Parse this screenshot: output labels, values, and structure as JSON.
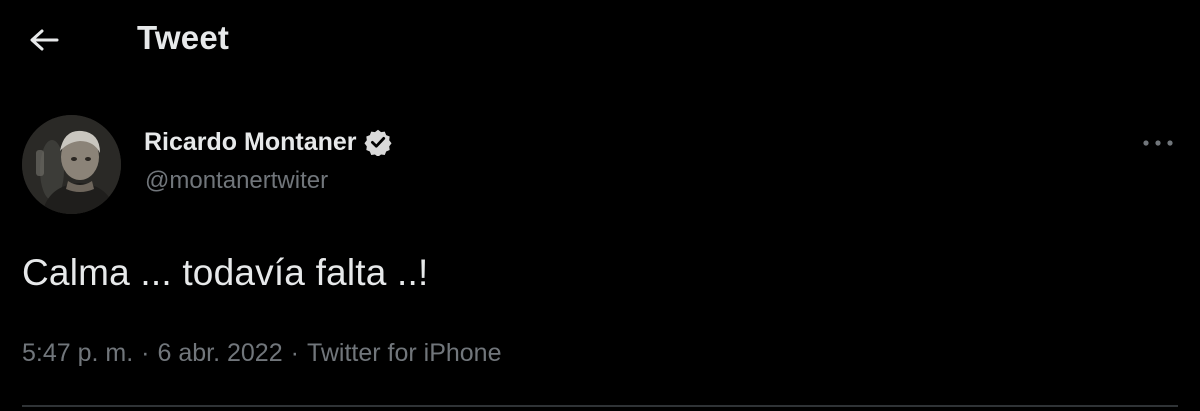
{
  "header": {
    "title": "Tweet",
    "back_icon": "arrow-left-icon"
  },
  "tweet": {
    "author": {
      "display_name": "Ricardo Montaner",
      "handle": "@montanertwiter",
      "verified": true
    },
    "text": "Calma ... todavía falta ..!",
    "time": "5:47 p. m.",
    "separator": "·",
    "date": "6 abr. 2022",
    "source": "Twitter for iPhone"
  },
  "icons": {
    "back": "arrow-left-icon",
    "verified": "verified-badge-icon",
    "more": "more-dots-icon"
  },
  "colors": {
    "background": "#000000",
    "primary_text": "#e7e9ea",
    "secondary_text": "#71767b",
    "divider": "#2f3336"
  }
}
